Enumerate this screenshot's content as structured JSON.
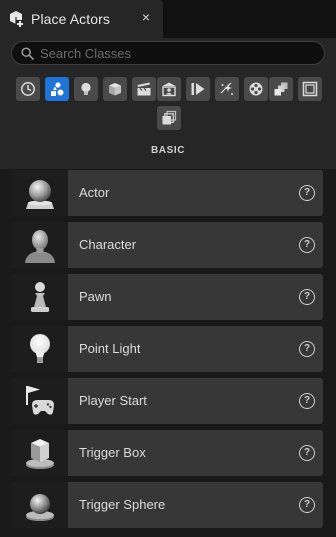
{
  "tab": {
    "title": "Place Actors",
    "close_glyph": "×",
    "icon": "place-actors-icon"
  },
  "search": {
    "placeholder": "Search Classes",
    "value": "",
    "icon": "search-icon"
  },
  "categories": [
    {
      "name": "recently-placed",
      "icon": "clock-icon",
      "active": false
    },
    {
      "name": "basic",
      "icon": "basic-shapes-icon",
      "active": true
    },
    {
      "name": "lights",
      "icon": "lightbulb-icon",
      "active": false
    },
    {
      "name": "shapes",
      "icon": "cube-icon",
      "active": false
    },
    {
      "name": "cinematic",
      "icon": "clapperboard-icon",
      "active": false
    },
    {
      "name": "visual-effects",
      "icon": "portrait-icon",
      "active": false
    },
    {
      "name": "volumes",
      "icon": "play-volume-icon",
      "active": false
    },
    {
      "name": "all-classes-fx",
      "icon": "sparkles-icon",
      "active": false
    },
    {
      "name": "geometry",
      "icon": "film-reel-icon",
      "active": false
    },
    {
      "name": "all-classes",
      "icon": "stacked-boxes-icon",
      "active": false
    },
    {
      "name": "panel",
      "icon": "panel-frame-icon",
      "active": false
    },
    {
      "name": "more",
      "icon": "stacked-pages-icon",
      "active": false
    }
  ],
  "category_label": "BASIC",
  "actors": [
    {
      "label": "Actor",
      "icon": "sphere-on-base-icon",
      "help": "?"
    },
    {
      "label": "Character",
      "icon": "character-head-icon",
      "help": "?"
    },
    {
      "label": "Pawn",
      "icon": "pawn-icon",
      "help": "?"
    },
    {
      "label": "Point Light",
      "icon": "lightbulb-icon",
      "help": "?"
    },
    {
      "label": "Player Start",
      "icon": "flag-gamepad-icon",
      "help": "?"
    },
    {
      "label": "Trigger Box",
      "icon": "box-on-base-icon",
      "help": "?"
    },
    {
      "label": "Trigger Sphere",
      "icon": "sphere-on-disc-icon",
      "help": "?"
    }
  ]
}
